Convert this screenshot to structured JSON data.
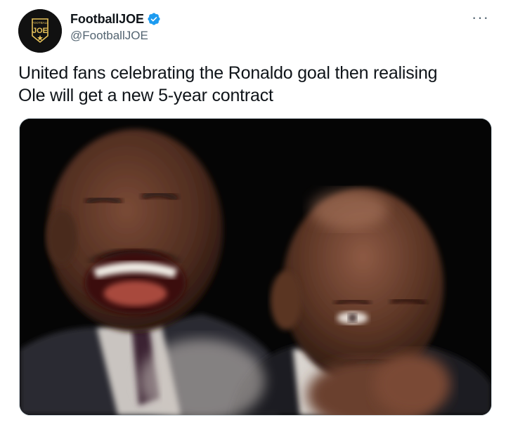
{
  "tweet": {
    "author": {
      "display_name": "FootballJOE",
      "handle": "@FootballJOE",
      "verified": true,
      "avatar_logo_text": "JOE",
      "avatar_logo_small": "FOOTBALL"
    },
    "more_label": "···",
    "text_line1": "United fans celebrating the Ronaldo goal then realising",
    "text_line2": "Ole will get a new 5-year contract",
    "media": {
      "icon": "photo-meme-icon"
    }
  },
  "colors": {
    "verified_blue": "#1d9bf0",
    "handle_gray": "#536471",
    "text": "#0f1419",
    "border": "#cfd9de"
  }
}
